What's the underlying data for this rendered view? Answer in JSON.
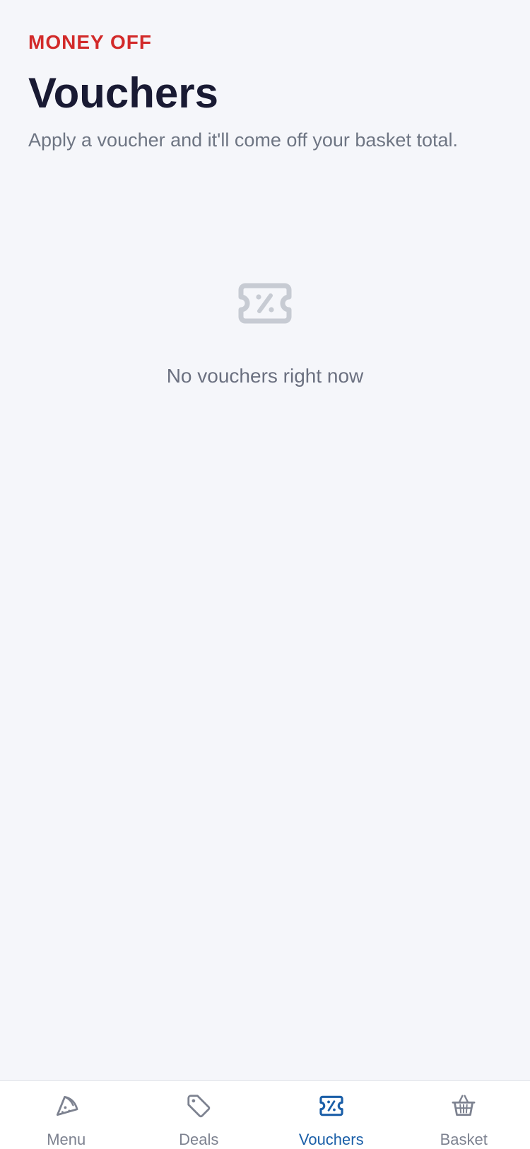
{
  "header": {
    "eyebrow": "MONEY OFF",
    "title": "Vouchers",
    "subtitle": "Apply a voucher and it'll come off your basket total."
  },
  "empty_state": {
    "icon": "voucher-icon",
    "message": "No vouchers right now"
  },
  "tabbar": {
    "active": "Vouchers",
    "tabs": [
      {
        "label": "Menu",
        "icon": "pizza-slice-icon"
      },
      {
        "label": "Deals",
        "icon": "tag-icon"
      },
      {
        "label": "Vouchers",
        "icon": "voucher-icon"
      },
      {
        "label": "Basket",
        "icon": "basket-icon"
      }
    ]
  },
  "colors": {
    "background": "#f5f6fa",
    "eyebrow": "#d22a2a",
    "title": "#191a33",
    "muted_text": "#6e7583",
    "icon_muted": "#c7cbd3",
    "tab_inactive": "#7d8290",
    "tab_active": "#1b5fa8"
  }
}
